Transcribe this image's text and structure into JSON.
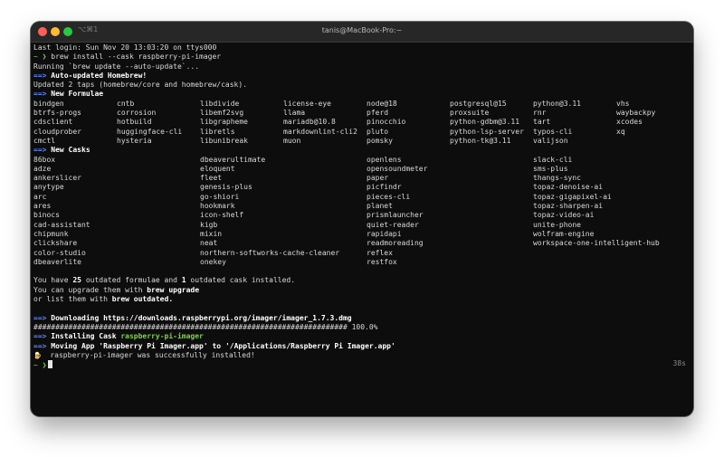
{
  "window": {
    "shortcut": "⌥⌘1",
    "title": "tanis@MacBook-Pro:~"
  },
  "terminal": {
    "last_login": "Last login: Sun Nov 20 13:03:20 on ttys000",
    "prompt_symbol": "~ ❯",
    "command": "brew install --cask raspberry-pi-imager",
    "running": "Running `brew update --auto-update`...",
    "arrow": "==>",
    "auto_updated": "Auto-updated Homebrew!",
    "updated_taps": "Updated 2 taps (homebrew/core and homebrew/cask).",
    "new_formulae_heading": "New Formulae",
    "formulae": [
      "bindgen",
      "cntb",
      "libdivide",
      "license-eye",
      "node@18",
      "postgresql@15",
      "python@3.11",
      "vhs",
      "btrfs-progs",
      "corrosion",
      "libemf2svg",
      "llama",
      "pferd",
      "proxsuite",
      "rnr",
      "waybackpy",
      "cdsclient",
      "hotbuild",
      "libgrapheme",
      "mariadb@10.8",
      "pinocchio",
      "python-gdbm@3.11",
      "tart",
      "xcodes",
      "cloudprober",
      "huggingface-cli",
      "libretls",
      "markdownlint-cli2",
      "pluto",
      "python-lsp-server",
      "typos-cli",
      "xq",
      "cmctl",
      "hysteria",
      "libunibreak",
      "muon",
      "pomsky",
      "python-tk@3.11",
      "valijson",
      ""
    ],
    "new_casks_heading": "New Casks",
    "casks": [
      "86box",
      "dbeaverultimate",
      "openlens",
      "slack-cli",
      "adze",
      "eloquent",
      "opensoundmeter",
      "sms-plus",
      "ankerslicer",
      "fleet",
      "paper",
      "thangs-sync",
      "anytype",
      "genesis-plus",
      "picfindr",
      "topaz-denoise-ai",
      "arc",
      "go-shiori",
      "pieces-cli",
      "topaz-gigapixel-ai",
      "ares",
      "hookmark",
      "planet",
      "topaz-sharpen-ai",
      "binocs",
      "icon-shelf",
      "prismlauncher",
      "topaz-video-ai",
      "cad-assistant",
      "kigb",
      "quiet-reader",
      "unite-phone",
      "chipmunk",
      "mixin",
      "rapidapi",
      "wolfram-engine",
      "clickshare",
      "neat",
      "readmoreading",
      "workspace-one-intelligent-hub",
      "color-studio",
      "northern-softworks-cache-cleaner",
      "reflex",
      "",
      "dbeaverlite",
      "onekey",
      "restfox",
      ""
    ],
    "outdated_pre": "You have ",
    "outdated_formulae_count": "25",
    "outdated_mid": " outdated formulae and ",
    "outdated_cask_count": "1",
    "outdated_post": " outdated cask installed.",
    "upgrade_pre": "You can upgrade them with ",
    "upgrade_cmd": "brew upgrade",
    "list_pre": "or list them with ",
    "list_cmd": "brew outdated.",
    "downloading": "Downloading https://downloads.raspberrypi.org/imager/imager_1.7.3.dmg",
    "progress_bar": "######################################################################## 100.0%",
    "installing_label": "Installing Cask ",
    "installing_name": "raspberry-pi-imager",
    "moving": "Moving App 'Raspberry Pi Imager.app' to '/Applications/Raspberry Pi Imager.app'",
    "beer_icon": "🍺",
    "success": "raspberry-pi-imager was successfully installed!",
    "elapsed": "38s"
  },
  "colors": {
    "arrow": "#5f86ff",
    "prompt": "#7fd34a",
    "background": "#0d0d0d"
  }
}
